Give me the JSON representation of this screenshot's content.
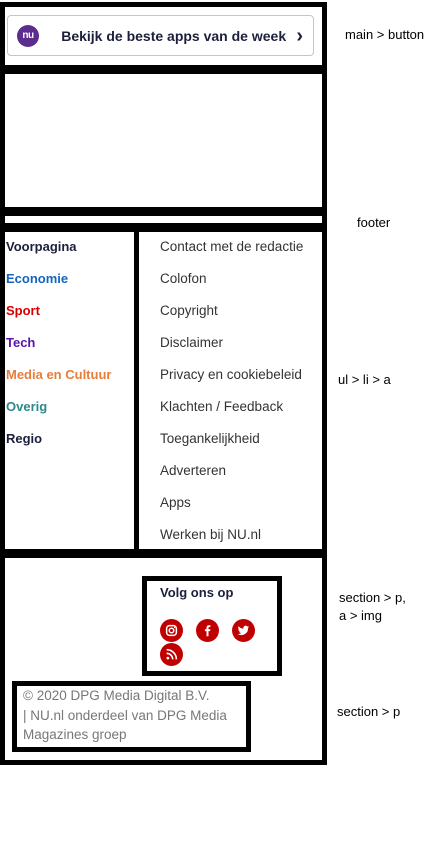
{
  "banner": {
    "logo_text": "nu",
    "label": "Bekijk de beste apps van de week"
  },
  "categories": [
    {
      "label": "Voorpagina",
      "color": "#1b1f3b"
    },
    {
      "label": "Economie",
      "color": "#1565c0"
    },
    {
      "label": "Sport",
      "color": "#d60000"
    },
    {
      "label": "Tech",
      "color": "#5b13a8"
    },
    {
      "label": "Media en Cultuur",
      "color": "#e67e3a"
    },
    {
      "label": "Overig",
      "color": "#2c8a8a"
    },
    {
      "label": "Regio",
      "color": "#1b1f3b"
    }
  ],
  "links": [
    "Contact met de redactie",
    "Colofon",
    "Copyright",
    "Disclaimer",
    "Privacy en cookiebeleid",
    "Klachten / Feedback",
    "Toegankelijkheid",
    "Adverteren",
    "Apps",
    "Werken bij NU.nl"
  ],
  "social": {
    "title": "Volg ons op",
    "icons": [
      "instagram-icon",
      "facebook-icon",
      "twitter-icon",
      "rss-icon"
    ],
    "color": "#c00000"
  },
  "copyright": {
    "line1": "© 2020 DPG Media Digital B.V.",
    "line2": "| NU.nl onderdeel van DPG Media",
    "line3": "Magazines groep"
  },
  "annotations": {
    "main_button": "main > button",
    "footer": "footer",
    "list_links": "ul > li > a",
    "section_p_line1": "section > p,",
    "section_p_line2": "a > img",
    "section_p_copy": "section > p"
  }
}
